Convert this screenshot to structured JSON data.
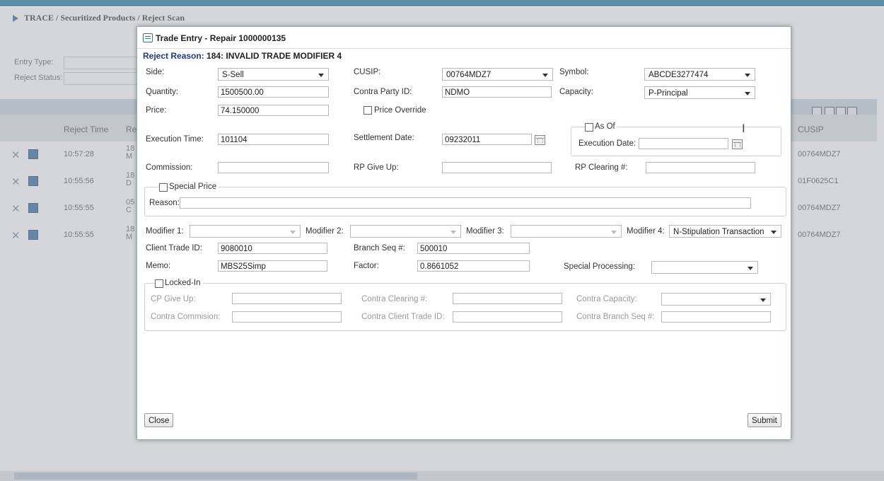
{
  "breadcrumb": "TRACE / Securitized Products / Reject Scan",
  "background": {
    "entry_type_label": "Entry Type:",
    "reject_status_label": "Reject Status:",
    "col_reject_time": "Reject Time",
    "col_re": "Re",
    "col_cusip": "CUSIP",
    "rows": [
      {
        "time": "10:57:28",
        "trunc_a": "18",
        "trunc_b": "M",
        "cusip": "00764MDZ7"
      },
      {
        "time": "10:55:56",
        "trunc_a": "18",
        "trunc_b": "D",
        "cusip": "01F0625C1"
      },
      {
        "time": "10:55:55",
        "trunc_a": "05",
        "trunc_b": "C",
        "cusip": "00764MDZ7"
      },
      {
        "time": "10:55:55",
        "trunc_a": "18",
        "trunc_b": "M",
        "cusip": "00764MDZ7"
      }
    ]
  },
  "dialog": {
    "title": "Trade Entry - Repair 1000000135",
    "reject_reason_label": "Reject Reason:",
    "reject_reason_value": "184: INVALID TRADE MODIFIER 4",
    "side": {
      "label": "Side:",
      "value": "S-Sell"
    },
    "cusip": {
      "label": "CUSIP:",
      "value": "00764MDZ7"
    },
    "symbol": {
      "label": "Symbol:",
      "value": "ABCDE3277474"
    },
    "quantity": {
      "label": "Quantity:",
      "value": "1500500.00"
    },
    "contra_party": {
      "label": "Contra Party ID:",
      "value": "NDMO"
    },
    "capacity": {
      "label": "Capacity:",
      "value": "P-Principal"
    },
    "price": {
      "label": "Price:",
      "value": "74.150000"
    },
    "price_override_label": "Price Override",
    "as_of_label": "As Of",
    "execution_time": {
      "label": "Execution Time:",
      "value": "101104"
    },
    "settlement_date": {
      "label": "Settlement Date:",
      "value": "09232011"
    },
    "execution_date_label": "Execution Date:",
    "commission_label": "Commission:",
    "rp_give_up_label": "RP Give Up:",
    "rp_clearing_label": "RP Clearing #:",
    "special_price_label": "Special Price",
    "reason_label": "Reason:",
    "modifier1_label": "Modifier 1:",
    "modifier2_label": "Modifier 2:",
    "modifier3_label": "Modifier 3:",
    "modifier4": {
      "label": "Modifier 4:",
      "value": "N-Stipulation Transaction"
    },
    "client_trade_id": {
      "label": "Client Trade ID:",
      "value": "9080010"
    },
    "branch_seq": {
      "label": "Branch Seq #:",
      "value": "500010"
    },
    "memo": {
      "label": "Memo:",
      "value": "MBS25Simp"
    },
    "factor": {
      "label": "Factor:",
      "value": "0.8661052"
    },
    "special_processing_label": "Special Processing:",
    "locked_in_label": "Locked-In",
    "cp_give_up_label": "CP Give Up:",
    "contra_clearing_label": "Contra Clearing #:",
    "contra_capacity_label": "Contra Capacity:",
    "contra_commission_label": "Contra Commision:",
    "contra_client_trade_label": "Contra Client Trade ID:",
    "contra_branch_seq_label": "Contra Branch Seq #:",
    "close_label": "Close",
    "submit_label": "Submit"
  }
}
